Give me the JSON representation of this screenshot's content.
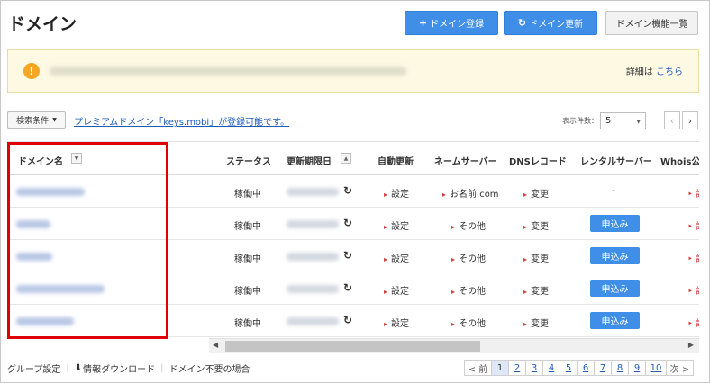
{
  "page": {
    "title": "ドメイン"
  },
  "toolbar": {
    "register_label": "ドメイン登録",
    "renew_label": "ドメイン更新",
    "functions_label": "ドメイン機能一覧",
    "register_icon": "plus-icon",
    "renew_icon": "refresh-icon"
  },
  "notice": {
    "icon": "info-icon",
    "detail_prefix": "詳細は",
    "detail_link": "こちら"
  },
  "filter": {
    "search_label": "検索条件",
    "promo_text": "プレミアムドメイン「keys.mobi」が登録可能です。",
    "count_label": "表示件数：",
    "count_value": "5"
  },
  "table": {
    "headers": {
      "domain": "ドメイン名",
      "status": "ステータス",
      "expiry": "更新期限日",
      "auto_renew": "自動更新",
      "nameserver": "ネームサーバー",
      "dns": "DNSレコード",
      "rental": "レンタルサーバー",
      "whois": "Whois公"
    },
    "rows": [
      {
        "status": "稼働中",
        "auto": "設定",
        "ns": "お名前.com",
        "dns": "変更",
        "rental": "-",
        "whois": "‣ 設"
      },
      {
        "status": "稼働中",
        "auto": "設定",
        "ns": "その他",
        "dns": "変更",
        "rental": "申込み",
        "whois": "‣ 設"
      },
      {
        "status": "稼働中",
        "auto": "設定",
        "ns": "その他",
        "dns": "変更",
        "rental": "申込み",
        "whois": "‣ 設"
      },
      {
        "status": "稼働中",
        "auto": "設定",
        "ns": "その他",
        "dns": "変更",
        "rental": "申込み",
        "whois": "‣ 設"
      },
      {
        "status": "稼働中",
        "auto": "設定",
        "ns": "その他",
        "dns": "変更",
        "rental": "申込み",
        "whois": "‣ 設"
      }
    ]
  },
  "footer": {
    "group": "グループ設定",
    "download": "情報ダウンロード",
    "unneeded": "ドメイン不要の場合",
    "prev": "< 前",
    "next": "次 >",
    "pages": [
      "1",
      "2",
      "3",
      "4",
      "5",
      "6",
      "7",
      "8",
      "9",
      "10"
    ]
  },
  "colors": {
    "accent": "#3f8ee8",
    "highlight": "#e00000",
    "notice_bg": "#fdf9e3"
  }
}
